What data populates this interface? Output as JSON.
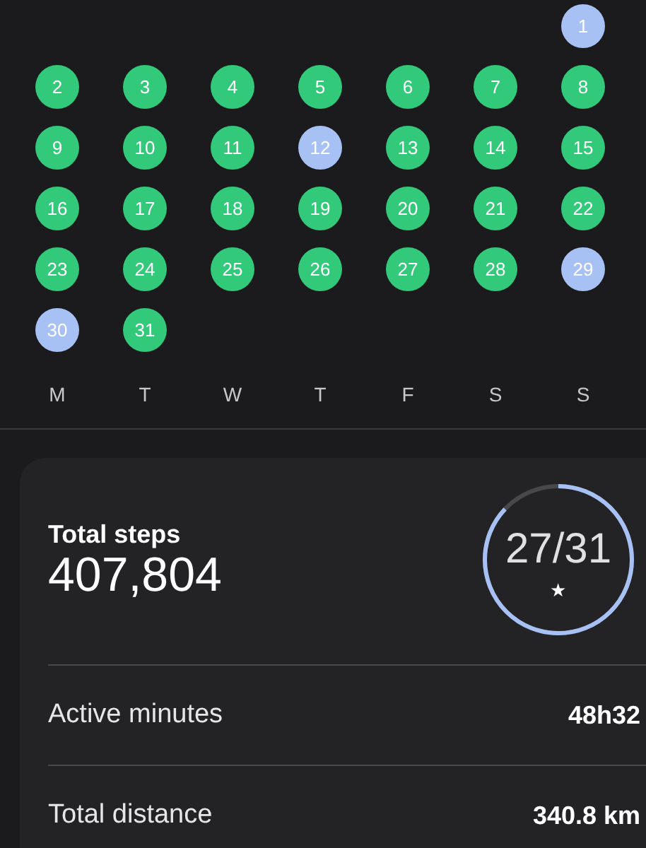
{
  "calendar": {
    "weeks": [
      [
        {
          "kind": "blank"
        },
        {
          "kind": "blank"
        },
        {
          "kind": "blank"
        },
        {
          "kind": "blank"
        },
        {
          "kind": "blank"
        },
        {
          "kind": "blank"
        },
        {
          "kind": "day",
          "day": "1",
          "color": "#a8c1f5"
        }
      ],
      [
        {
          "kind": "day",
          "day": "2",
          "color": "#33c97a"
        },
        {
          "kind": "day",
          "day": "3",
          "color": "#33c97a"
        },
        {
          "kind": "day",
          "day": "4",
          "color": "#33c97a"
        },
        {
          "kind": "day",
          "day": "5",
          "color": "#33c97a"
        },
        {
          "kind": "day",
          "day": "6",
          "color": "#33c97a"
        },
        {
          "kind": "day",
          "day": "7",
          "color": "#33c97a"
        },
        {
          "kind": "day",
          "day": "8",
          "color": "#33c97a"
        }
      ],
      [
        {
          "kind": "day",
          "day": "9",
          "color": "#33c97a"
        },
        {
          "kind": "day",
          "day": "10",
          "color": "#33c97a"
        },
        {
          "kind": "day",
          "day": "11",
          "color": "#33c97a"
        },
        {
          "kind": "day",
          "day": "12",
          "color": "#a8c1f5"
        },
        {
          "kind": "day",
          "day": "13",
          "color": "#33c97a"
        },
        {
          "kind": "day",
          "day": "14",
          "color": "#33c97a"
        },
        {
          "kind": "day",
          "day": "15",
          "color": "#33c97a"
        }
      ],
      [
        {
          "kind": "day",
          "day": "16",
          "color": "#33c97a"
        },
        {
          "kind": "day",
          "day": "17",
          "color": "#33c97a"
        },
        {
          "kind": "day",
          "day": "18",
          "color": "#33c97a"
        },
        {
          "kind": "day",
          "day": "19",
          "color": "#33c97a"
        },
        {
          "kind": "day",
          "day": "20",
          "color": "#33c97a"
        },
        {
          "kind": "day",
          "day": "21",
          "color": "#33c97a"
        },
        {
          "kind": "day",
          "day": "22",
          "color": "#33c97a"
        }
      ],
      [
        {
          "kind": "day",
          "day": "23",
          "color": "#33c97a"
        },
        {
          "kind": "day",
          "day": "24",
          "color": "#33c97a"
        },
        {
          "kind": "day",
          "day": "25",
          "color": "#33c97a"
        },
        {
          "kind": "day",
          "day": "26",
          "color": "#33c97a"
        },
        {
          "kind": "day",
          "day": "27",
          "color": "#33c97a"
        },
        {
          "kind": "day",
          "day": "28",
          "color": "#33c97a"
        },
        {
          "kind": "day",
          "day": "29",
          "color": "#a8c1f5"
        }
      ],
      [
        {
          "kind": "day",
          "day": "30",
          "color": "#a8c1f5"
        },
        {
          "kind": "day",
          "day": "31",
          "color": "#33c97a"
        }
      ]
    ],
    "weekdays": [
      "M",
      "T",
      "W",
      "T",
      "F",
      "S",
      "S"
    ]
  },
  "summary": {
    "title": "Total steps",
    "value": "407,804",
    "goal": {
      "reading": "27/31",
      "mark": "★",
      "level": 0.87
    },
    "rows": [
      {
        "label": "Active minutes",
        "value": "48h32"
      },
      {
        "label": "Total distance",
        "value": "340.8 km"
      }
    ]
  }
}
